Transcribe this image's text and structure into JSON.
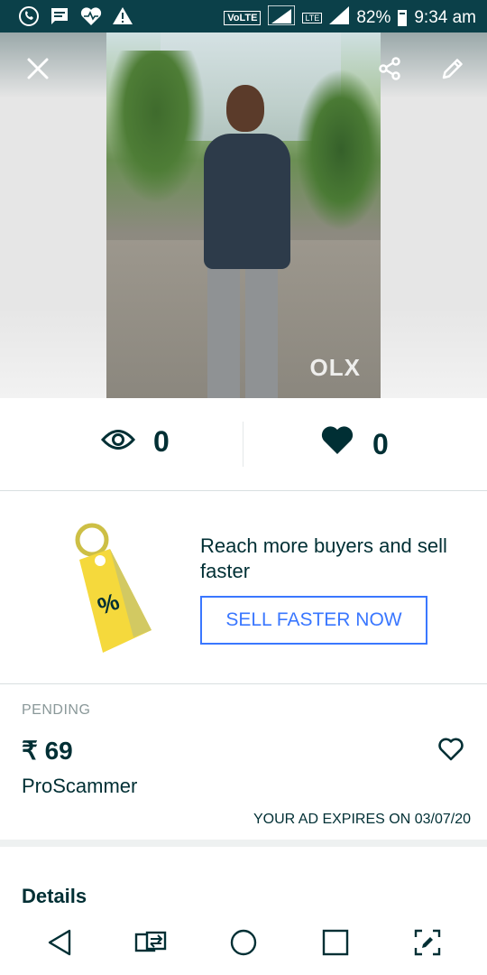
{
  "status_bar": {
    "battery": "82%",
    "time": "9:34 am",
    "network_label": "VoLTE",
    "lte_label": "LTE",
    "icons": [
      "whatsapp-icon",
      "message-icon",
      "health-icon",
      "warning-icon",
      "signal-icon",
      "battery-icon"
    ]
  },
  "photo": {
    "watermark": "OLX",
    "actions": [
      "close-icon",
      "share-icon",
      "edit-icon"
    ]
  },
  "stats": {
    "views": "0",
    "likes": "0"
  },
  "promo": {
    "headline": "Reach more buyers and sell faster",
    "cta_label": "SELL FASTER NOW",
    "tag_symbol": "%"
  },
  "listing": {
    "status": "PENDING",
    "price": "₹ 69",
    "title": "ProScammer",
    "expiry": "YOUR AD EXPIRES ON 03/07/20"
  },
  "details": {
    "heading": "Details"
  },
  "colors": {
    "status_bar_bg": "#0b4049",
    "text_primary": "#002f34",
    "cta_blue": "#3a77ff",
    "tag_yellow": "#f5d93c"
  }
}
